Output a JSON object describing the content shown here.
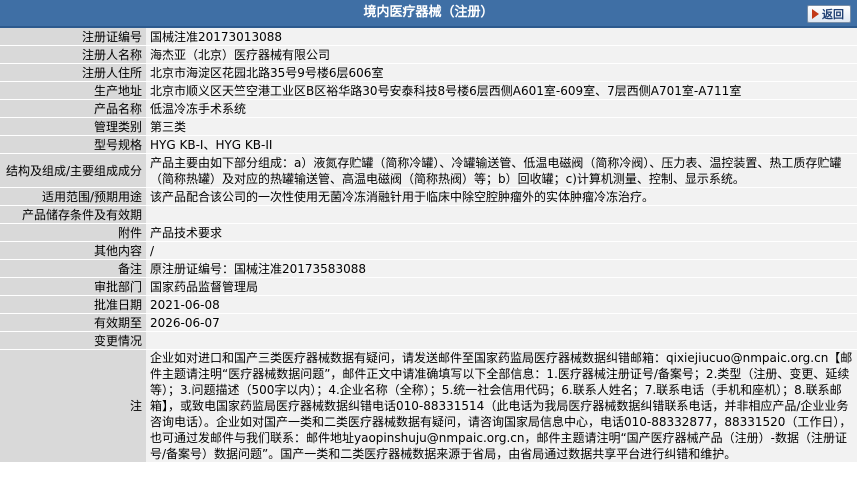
{
  "header": {
    "title": "境内医疗器械（注册）",
    "back_label": "返回"
  },
  "fields": {
    "reg_no": {
      "label": "注册证编号",
      "value": "国械注准20173013088"
    },
    "registrant": {
      "label": "注册人名称",
      "value": "海杰亚（北京）医疗器械有限公司"
    },
    "address": {
      "label": "注册人住所",
      "value": "北京市海淀区花园北路35号9号楼6层606室"
    },
    "mfg_address": {
      "label": "生产地址",
      "value": "北京市顺义区天竺空港工业区B区裕华路30号安泰科技8号楼6层西侧A601室-609室、7层西侧A701室-A711室"
    },
    "product_name": {
      "label": "产品名称",
      "value": "低温冷冻手术系统"
    },
    "category": {
      "label": "管理类别",
      "value": "第三类"
    },
    "model": {
      "label": "型号规格",
      "value": "HYG KB-I、HYG KB-II"
    },
    "composition": {
      "label": "结构及组成/主要组成成分",
      "value": "产品主要由如下部分组成：a）液氮存贮罐（简称冷罐）、冷罐输送管、低温电磁阀（简称冷阀）、压力表、温控装置、热工质存贮罐（简称热罐）及对应的热罐输送管、高温电磁阀（简称热阀）等；b）回收罐；c)计算机测量、控制、显示系统。"
    },
    "scope": {
      "label": "适用范围/预期用途",
      "value": "该产品配合该公司的一次性使用无菌冷冻消融针用于临床中除空腔肿瘤外的实体肿瘤冷冻治疗。"
    },
    "storage": {
      "label": "产品储存条件及有效期",
      "value": ""
    },
    "attachment": {
      "label": "附件",
      "value": "产品技术要求"
    },
    "other": {
      "label": "其他内容",
      "value": "/"
    },
    "remark": {
      "label": "备注",
      "value": "原注册证编号：国械注准20173583088"
    },
    "dept": {
      "label": "审批部门",
      "value": "国家药品监督管理局"
    },
    "approve_date": {
      "label": "批准日期",
      "value": "2021-06-08"
    },
    "expiry": {
      "label": "有效期至",
      "value": "2026-06-07"
    },
    "changes": {
      "label": "变更情况",
      "value": ""
    },
    "note": {
      "label": "注",
      "value": "企业如对进口和国产三类医疗器械数据有疑问，请发送邮件至国家药监局医疗器械数据纠错邮箱：qixiejiucuo@nmpaic.org.cn【邮件主题请注明“医疗器械数据问题”，邮件正文中请准确填写以下全部信息：1.医疗器械注册证号/备案号；2.类型（注册、变更、延续等）；3.问题描述（500字以内）；4.企业名称（全称）；5.统一社会信用代码；6.联系人姓名；7.联系电话（手机和座机）；8.联系邮箱】，或致电国家药监局医疗器械数据纠错电话010-88331514（此电话为我局医疗器械数据纠错联系电话，并非相应产品/企业业务咨询电话）。企业如对国产一类和二类医疗器械数据有疑问，请咨询国家局信息中心，电话010-88332877，88331520（工作日），也可通过发邮件与我们联系：邮件地址yaopinshuju@nmpaic.org.cn，邮件主题请注明“国产医疗器械产品（注册）-数据（注册证号/备案号）数据问题”。国产一类和二类医疗器械数据来源于省局，由省局通过数据共享平台进行纠错和维护。"
    }
  }
}
